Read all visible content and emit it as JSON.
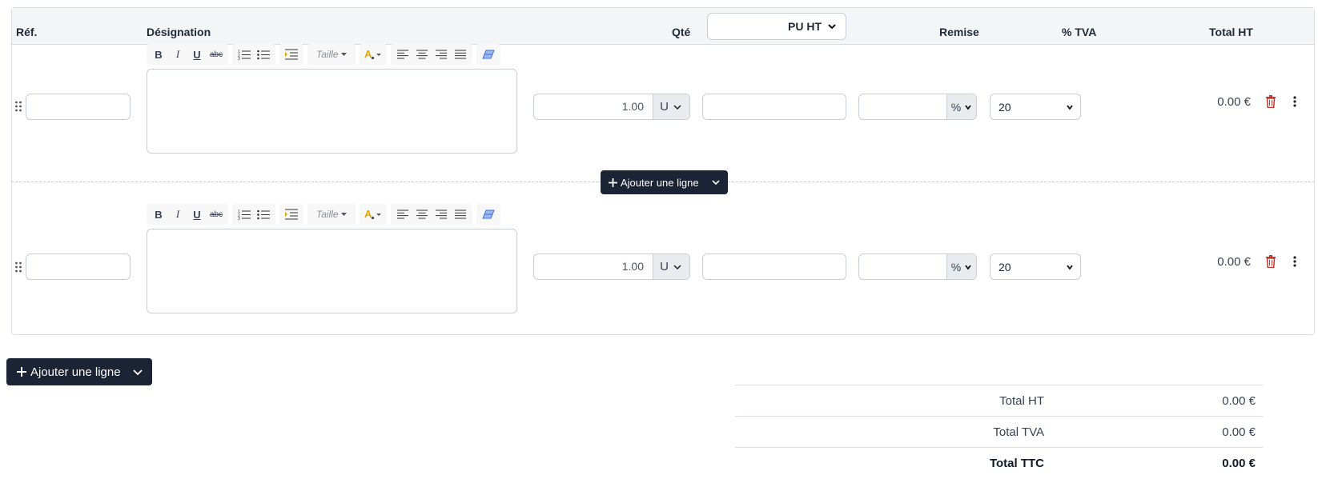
{
  "table": {
    "headers": {
      "ref": "Réf.",
      "designation": "Désignation",
      "qty": "Qté",
      "pu": "PU HT",
      "discount": "Remise",
      "vat": "% TVA",
      "total": "Total HT"
    }
  },
  "editor": {
    "size_label": "Taille"
  },
  "rows": [
    {
      "ref": "",
      "designation": "",
      "qty": "1.00",
      "unit": "U",
      "price": "",
      "discount": "",
      "discount_type": "%",
      "vat": "20",
      "total": "0.00 €"
    },
    {
      "ref": "",
      "designation": "",
      "qty": "1.00",
      "unit": "U",
      "price": "",
      "discount": "",
      "discount_type": "%",
      "vat": "20",
      "total": "0.00 €"
    }
  ],
  "actions": {
    "add_line": "Ajouter une ligne"
  },
  "totals": {
    "total_ht_label": "Total HT",
    "total_ht": "0.00 €",
    "total_tva_label": "Total TVA",
    "total_tva": "0.00 €",
    "total_ttc_label": "Total TTC",
    "total_ttc": "0.00 €"
  },
  "colors": {
    "dark_button": "#1b2434",
    "delete_icon": "#c0392b",
    "eraser_icon": "#3b6fd8",
    "color_icon": "#e0a800"
  }
}
